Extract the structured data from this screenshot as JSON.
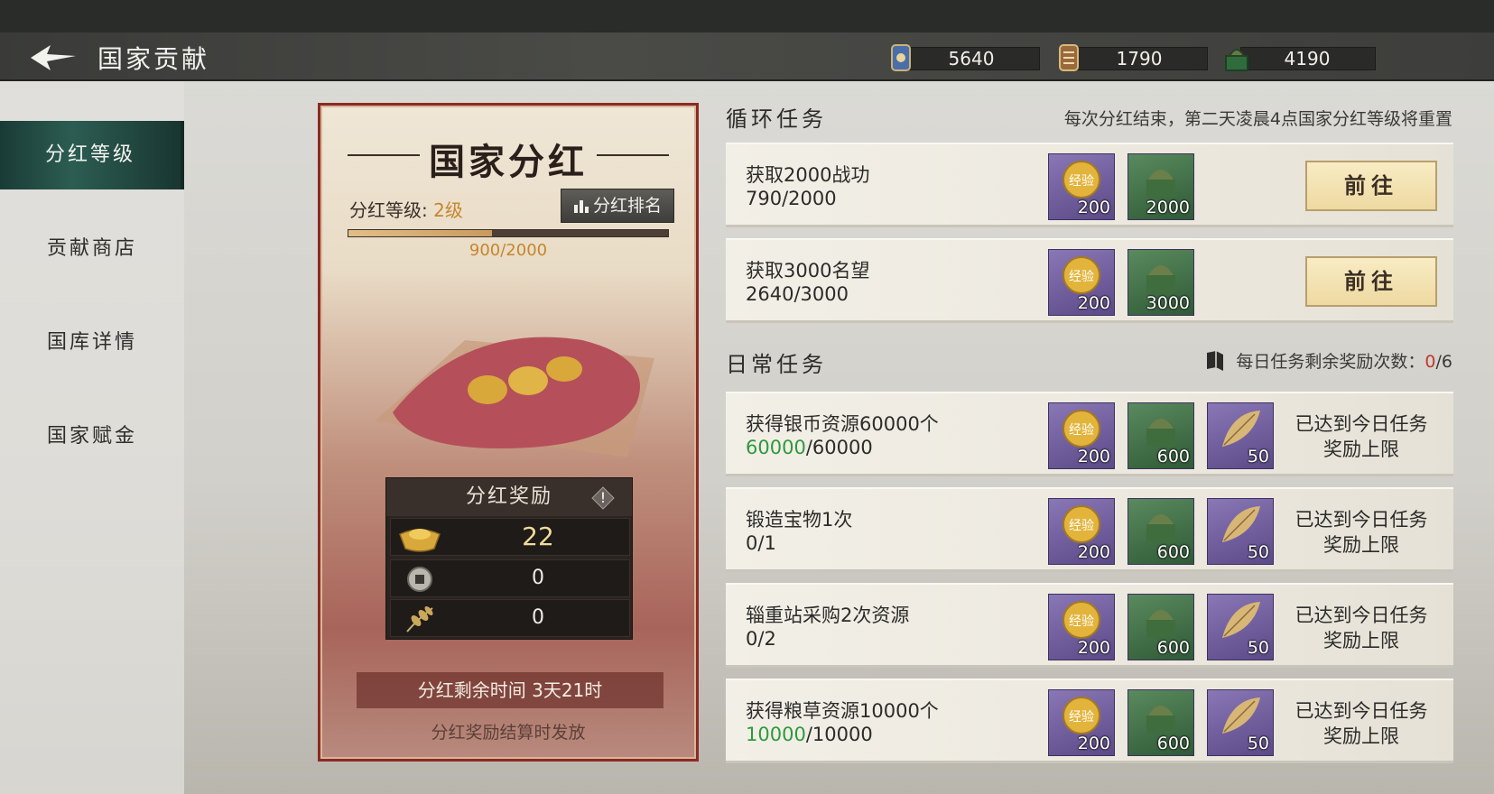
{
  "header": {
    "title": "国家贡献",
    "resources": [
      {
        "icon": "gold-token-icon",
        "value": "5640"
      },
      {
        "icon": "scroll-token-icon",
        "value": "1790"
      },
      {
        "icon": "jade-seal-icon",
        "value": "4190"
      }
    ]
  },
  "sidebar": {
    "items": [
      {
        "label": "分红等级",
        "active": true
      },
      {
        "label": "贡献商店",
        "active": false
      },
      {
        "label": "国库详情",
        "active": false
      },
      {
        "label": "国家赋金",
        "active": false
      }
    ]
  },
  "dividend": {
    "title": "国家分红",
    "level_label": "分红等级: ",
    "level_value": "2级",
    "rank_button": "分红排名",
    "progress_text": "900/2000",
    "progress_fraction": 0.45,
    "reward_title": "分红奖励",
    "rewards": [
      {
        "icon": "gold-ingot-icon",
        "value": "22"
      },
      {
        "icon": "copper-coin-icon",
        "value": "0"
      },
      {
        "icon": "grain-icon",
        "value": "0"
      }
    ],
    "timer": "分红剩余时间 3天21时",
    "settle_note": "分红奖励结算时发放"
  },
  "cycle": {
    "title": "循环任务",
    "note": "每次分红结束，第二天凌晨4点国家分红等级将重置",
    "tasks": [
      {
        "name": "获取2000战功",
        "progress": "790/2000",
        "rewards": [
          "200",
          "2000"
        ],
        "button": "前往"
      },
      {
        "name": "获取3000名望",
        "progress": "2640/3000",
        "rewards": [
          "200",
          "3000"
        ],
        "button": "前往"
      }
    ]
  },
  "daily": {
    "title": "日常任务",
    "note_label": "每日任务剩余奖励次数：",
    "note_cur": "0",
    "note_total": "/6",
    "tasks": [
      {
        "name": "获得银币资源60000个",
        "cur": "60000",
        "total": "/60000",
        "done": true,
        "rewards": [
          "200",
          "600",
          "50"
        ],
        "status_line1": "已达到今日任务",
        "status_line2": "奖励上限"
      },
      {
        "name": "锻造宝物1次",
        "cur": "0",
        "total": "/1",
        "done": false,
        "rewards": [
          "200",
          "600",
          "50"
        ],
        "status_line1": "已达到今日任务",
        "status_line2": "奖励上限"
      },
      {
        "name": "辎重站采购2次资源",
        "cur": "0",
        "total": "/2",
        "done": false,
        "rewards": [
          "200",
          "600",
          "50"
        ],
        "status_line1": "已达到今日任务",
        "status_line2": "奖励上限"
      },
      {
        "name": "获得粮草资源10000个",
        "cur": "10000",
        "total": "/10000",
        "done": true,
        "rewards": [
          "200",
          "600",
          "50"
        ],
        "status_line1": "已达到今日任务",
        "status_line2": "奖励上限"
      }
    ]
  },
  "colors": {
    "accent_green": "#2d9a3c",
    "accent_gold": "#c6862c",
    "sidebar_active": "#1f4a42",
    "card_border": "#8c2a22"
  }
}
